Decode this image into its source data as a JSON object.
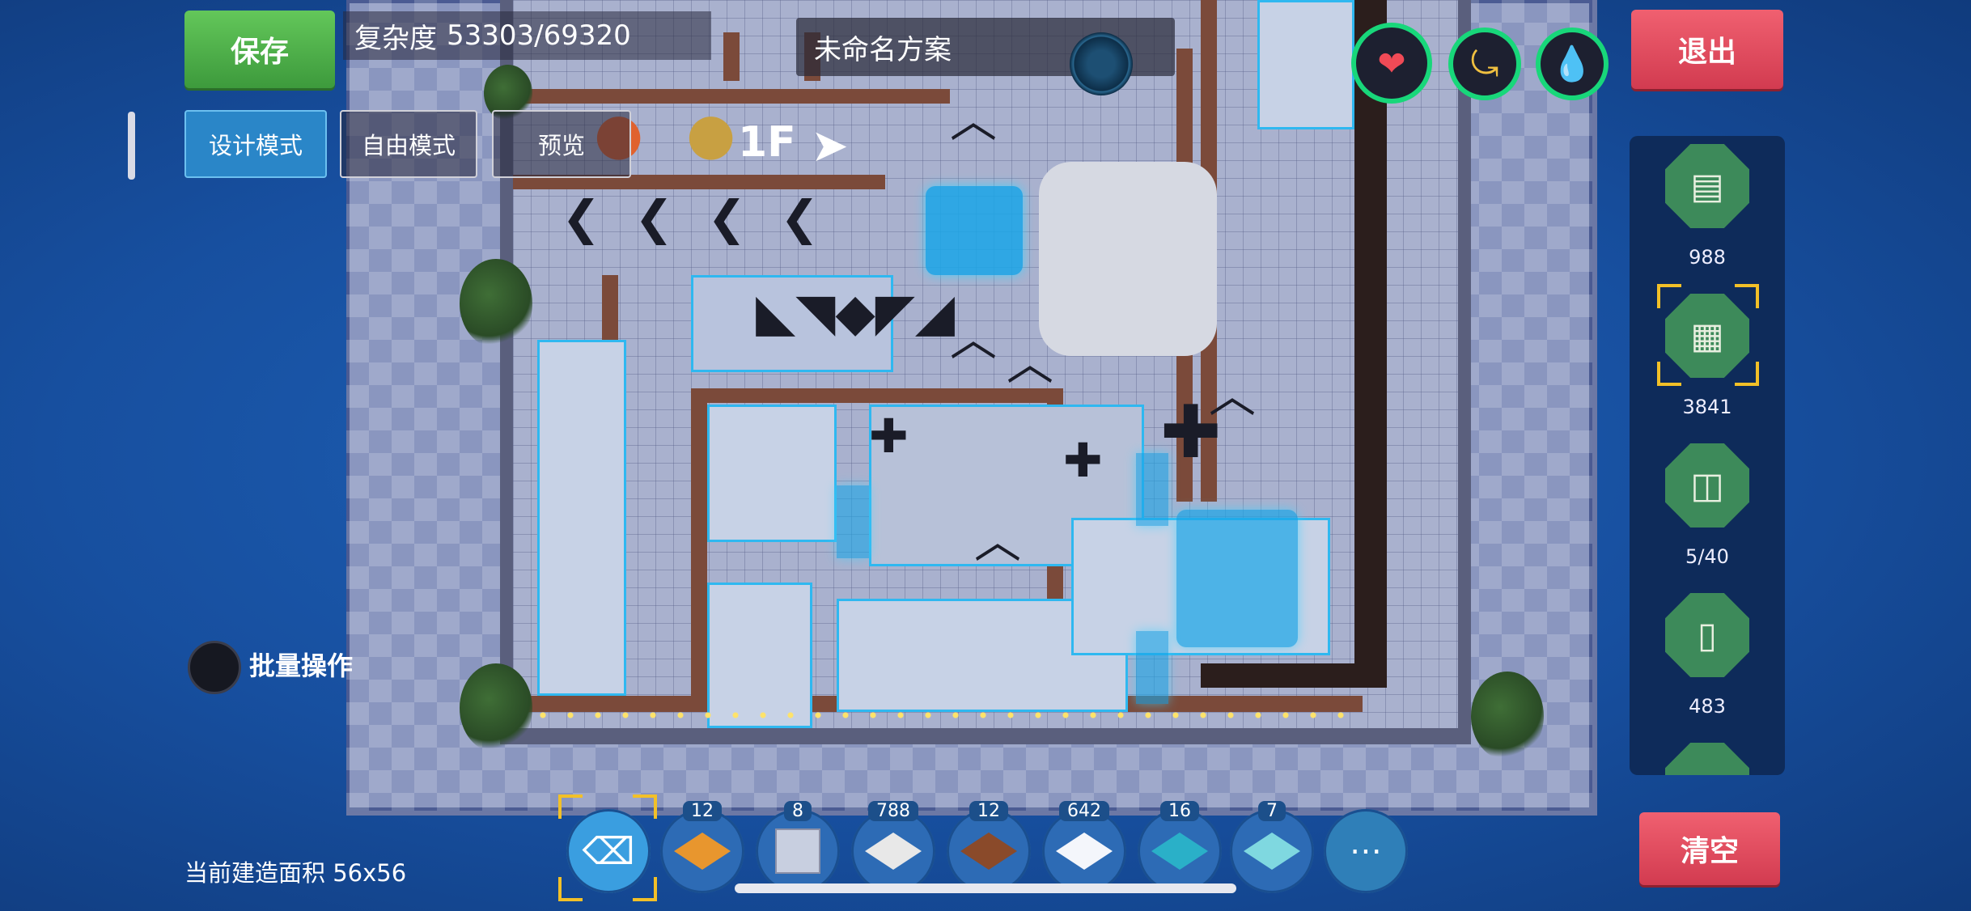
{
  "hud": {
    "save_label": "保存",
    "complexity_label": "复杂度",
    "complexity_value": "53303/69320",
    "scheme_name": "未命名方案",
    "exit_label": "退出",
    "clear_label": "清空"
  },
  "modes": {
    "design": "设计模式",
    "free": "自由模式",
    "preview": "预览",
    "active": "design"
  },
  "floor": {
    "label": "1F",
    "next_icon": "chevron-right-icon"
  },
  "stats": {
    "heart_icon": "heart-icon",
    "stomach_icon": "stomach-icon",
    "water_icon": "water-drop-icon",
    "ring_color": "#18d77a"
  },
  "palette": {
    "items": [
      {
        "name": "wall-icon",
        "count": "988"
      },
      {
        "name": "floor-pattern-icon",
        "count": "3841",
        "selected": true
      },
      {
        "name": "door-icon",
        "count": "5/40"
      },
      {
        "name": "pillar-icon",
        "count": "483"
      }
    ]
  },
  "batch": {
    "label": "批量操作"
  },
  "bottom": {
    "area_label": "当前建造面积 56x56",
    "tools": [
      {
        "name": "eraser-icon",
        "count": ""
      },
      {
        "name": "orange-diamond-tile",
        "count": "12",
        "color": "#e8962e"
      },
      {
        "name": "stone-block",
        "count": "8",
        "color": "#c8cfe0"
      },
      {
        "name": "pattern-tile",
        "count": "788",
        "color": "#e8e8e8"
      },
      {
        "name": "brown-tile",
        "count": "12",
        "color": "#8a4a2a"
      },
      {
        "name": "white-tile",
        "count": "642",
        "color": "#f4f6fb"
      },
      {
        "name": "teal-tile",
        "count": "16",
        "color": "#2ab0c8"
      },
      {
        "name": "light-teal-tile",
        "count": "7",
        "color": "#7fd8e0"
      }
    ],
    "more_icon": "more-icon"
  },
  "colors": {
    "accent_green": "#4cb448",
    "accent_red": "#e04a5e",
    "background": "#174f9f"
  }
}
